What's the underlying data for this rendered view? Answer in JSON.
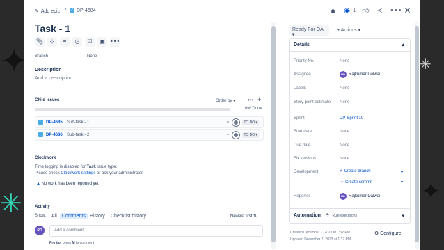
{
  "breadcrumb": {
    "add_epic": "Add epic",
    "separator": "/",
    "issue_key": "DP-4684"
  },
  "header": {
    "watch_count": "1"
  },
  "issue": {
    "title": "Task - 1"
  },
  "fields_left": {
    "branch_label": "Branch",
    "branch_value": "None"
  },
  "description": {
    "heading": "Description",
    "placeholder": "Add a description..."
  },
  "child_issues": {
    "heading": "Child issues",
    "order_by": "Order by",
    "progress_text": "0% Done",
    "progress_done": 0,
    "items": [
      {
        "key": "DP-4685",
        "summary": "Sub-task - 1",
        "status": "TO DO"
      },
      {
        "key": "DP-4686",
        "summary": "Sub-task - 2",
        "status": "TO DO"
      }
    ]
  },
  "clockwork": {
    "heading": "Clockwork",
    "line1_prefix": "Time logging is disabled for ",
    "line1_bold": "Task",
    "line1_suffix": " issue type.",
    "line2_prefix": "Please check ",
    "line2_link": "Clockwork settings",
    "line2_suffix": " or ask your administrator.",
    "warning": "No work has been reported yet"
  },
  "activity": {
    "heading": "Activity",
    "show_label": "Show:",
    "filters": [
      "All",
      "Comments",
      "History",
      "Checklist history"
    ],
    "active_filter": "Comments",
    "sort": "Newest first",
    "comment_placeholder": "Add a comment...",
    "avatar_initials": "RD",
    "protip_prefix": "Pro tip:",
    "protip_middle": " press ",
    "protip_key": "M",
    "protip_suffix": " to comment"
  },
  "status_button": "Ready For QA",
  "actions_button": "Actions",
  "details": {
    "heading": "Details",
    "fields": [
      {
        "label": "Priority No.",
        "value": "None"
      },
      {
        "label": "Assignee",
        "value": "Rajkumar Dalwai"
      },
      {
        "label": "Labels",
        "value": "None"
      },
      {
        "label": "Story point estimate",
        "value": "None"
      },
      {
        "label": "Sprint",
        "value": "DP-Sprint 19"
      },
      {
        "label": "Start date",
        "value": "None"
      },
      {
        "label": "Due date",
        "value": "None"
      },
      {
        "label": "Fix versions",
        "value": "None"
      },
      {
        "label": "Development",
        "value": "Create branch"
      },
      {
        "label": "",
        "value": "Create commit"
      },
      {
        "label": "Reporter",
        "value": "Rajkumar Dalwai"
      }
    ],
    "assignee_initials": "RD",
    "reporter_initials": "RD"
  },
  "automation": {
    "heading": "Automation",
    "rule_label": "Rule executions"
  },
  "meta": {
    "created": "Created December 7, 2023 at 1:32 PM",
    "updated": "Updated December 7, 2023 at 1:32 PM",
    "configure": "Configure"
  },
  "colors": {
    "accent": "#0052cc",
    "avatar": "#6554c0",
    "subtask": "#4bade8"
  }
}
